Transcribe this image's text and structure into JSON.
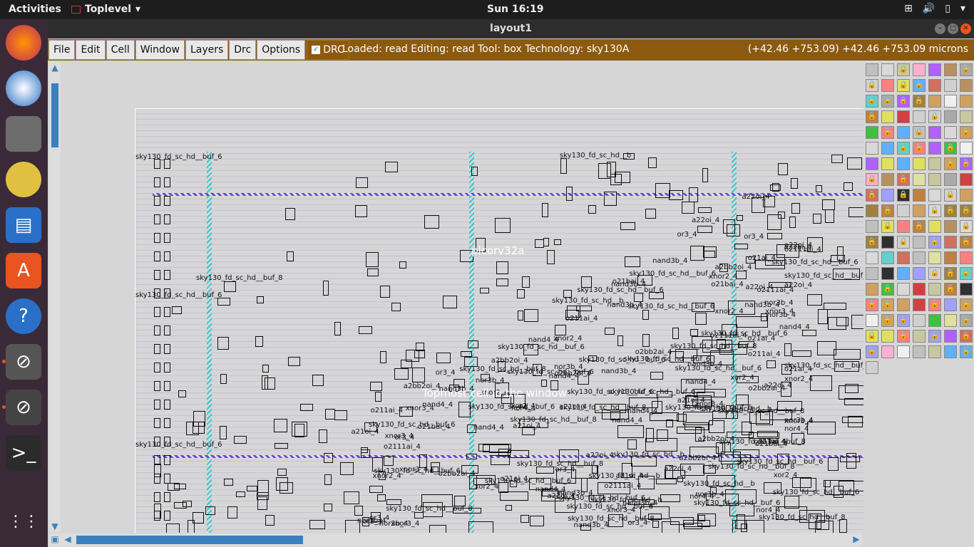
{
  "topbar": {
    "activities": "Activities",
    "app": "Toplevel",
    "clock": "Sun 16:19"
  },
  "window": {
    "title": "layout1"
  },
  "menu": [
    "File",
    "Edit",
    "Cell",
    "Window",
    "Layers",
    "Drc",
    "Options"
  ],
  "drc": {
    "label": "DRC",
    "checked": true
  },
  "status": "Loaded: read Editing: read Tool: box  Technology: sky130A",
  "coords": "(+42.46 +753.09) +42.46 +753.09 microns",
  "layout": {
    "cell_name": "picorv32a",
    "topmost_hint": "Topmost cell in the window",
    "labels": [
      "sky130_fd_sc_hd__buf_6",
      "sky130_fd_sc_hd__buf_8",
      "sky130_fd_sc_hd__b",
      "sky130_fd_sc_hd__buf_6",
      "sky130_fd_sc_hd__buf_6",
      "o21bai_4",
      "xnor2_4",
      "nand3b_4",
      "o21ai_4",
      "xor2_4",
      "a21oi_4",
      "xnor3_4",
      "nor3b_4",
      "nor4_4",
      "a2bb2oi_4",
      "o2bb2ai_4",
      "nand4_4",
      "a22oi_4",
      "or3_4",
      "o211ai_4",
      "o2111ai_4"
    ]
  },
  "colors": {
    "menubar": "#8b5a10",
    "dock": "#3a2a38",
    "accent": "#e95420",
    "canvas": "#d6d6d6",
    "rail": "#6b48d0",
    "strip": "#38c8d0"
  }
}
